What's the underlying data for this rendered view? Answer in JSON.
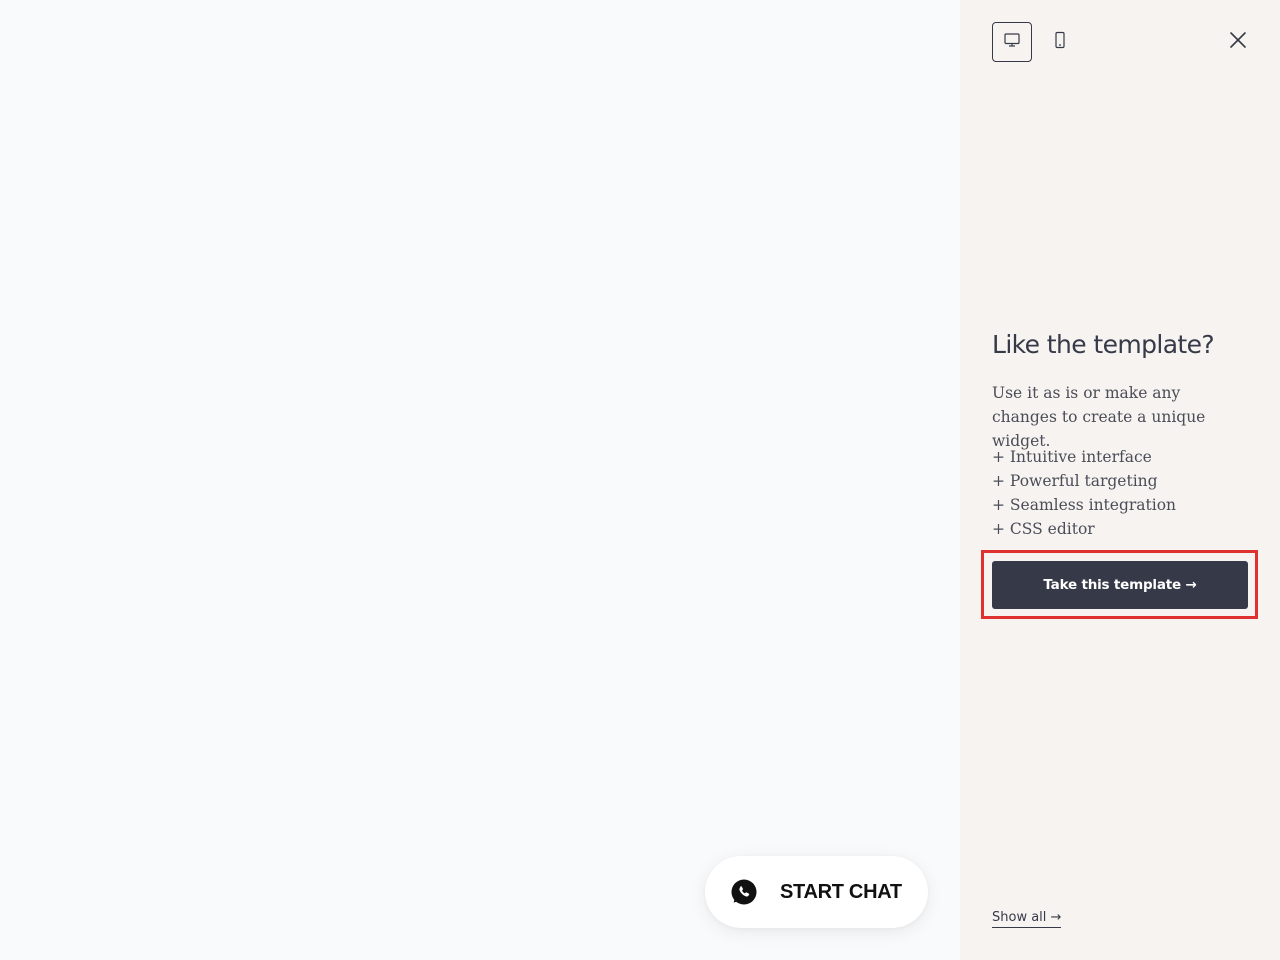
{
  "preview": {
    "chat_widget": {
      "label": "START CHAT",
      "icon": "whatsapp-icon"
    }
  },
  "sidebar": {
    "device_toggle": {
      "desktop_icon": "desktop-icon",
      "mobile_icon": "mobile-icon",
      "active": "desktop"
    },
    "close_icon": "close-icon",
    "promo": {
      "title": "Like the template?",
      "description": "Use it as is or make any changes to create a unique widget.",
      "features": [
        "+ Intuitive interface",
        "+ Powerful targeting",
        "+ Seamless integration",
        "+ CSS editor"
      ],
      "cta_label": "Take this template →"
    },
    "show_all_label": "Show all →"
  },
  "colors": {
    "sidebar_bg": "#f7f3f0",
    "preview_bg": "#f9fafc",
    "primary_dark": "#363a48",
    "highlight_red": "#e03131"
  }
}
